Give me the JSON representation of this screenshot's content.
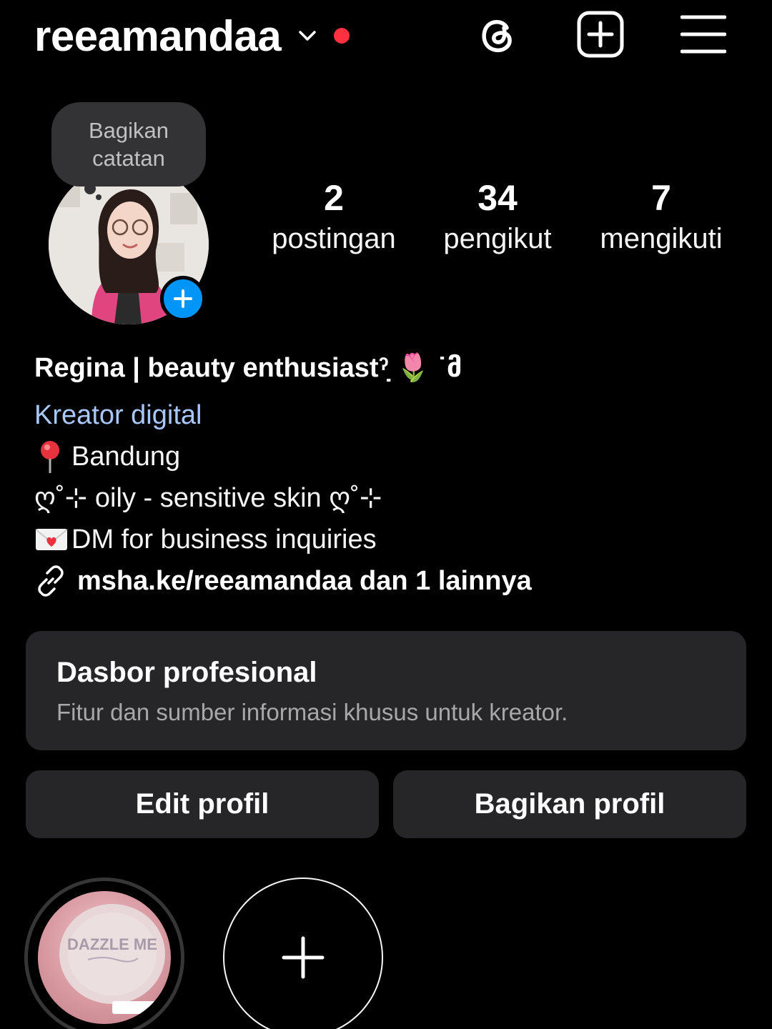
{
  "header": {
    "username": "reeamandaa"
  },
  "note": {
    "line1": "Bagikan",
    "line2": "catatan"
  },
  "stats": {
    "posts_count": "2",
    "posts_label": "postingan",
    "followers_count": "34",
    "followers_label": "pengikut",
    "following_count": "7",
    "following_label": "mengikuti"
  },
  "bio": {
    "name": "Regina | beauty enthusiastˀ̣ 🌷 ˙მ",
    "category": "Kreator digital",
    "location": "Bandung",
    "skin": "ღ˚⊹ oily - sensitive skin ღ˚⊹",
    "dm": "DM for business inquiries",
    "link": "msha.ke/reeamandaa dan 1 lainnya"
  },
  "dashboard": {
    "title": "Dasbor profesional",
    "subtitle": "Fitur dan sumber informasi khusus untuk kreator."
  },
  "buttons": {
    "edit": "Edit profil",
    "share": "Bagikan profil"
  },
  "highlights": {
    "item1_text": "DAZZLE ME"
  },
  "colors": {
    "accent_blue": "#0095f6",
    "notification_red": "#ff3040",
    "category_link": "#a8c7fa",
    "card_bg": "#262628"
  }
}
